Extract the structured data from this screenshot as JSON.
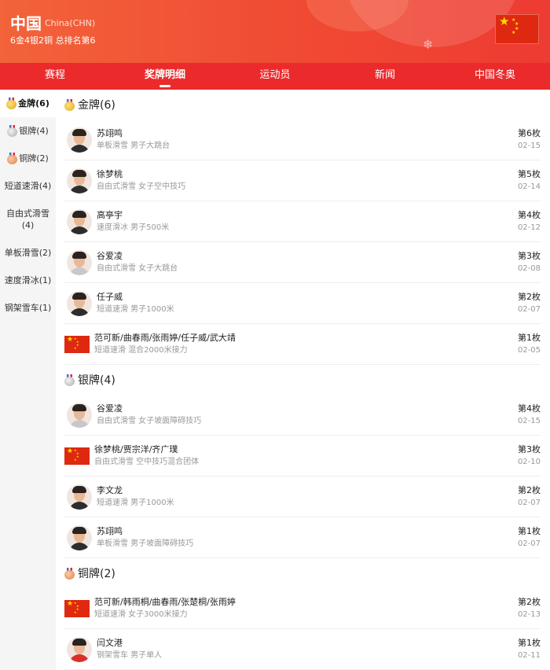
{
  "header": {
    "country_name": "中国",
    "country_code": "China(CHN)",
    "summary": "6金4银2铜 总排名第6"
  },
  "tabs": [
    {
      "label": "赛程",
      "active": false
    },
    {
      "label": "奖牌明细",
      "active": true
    },
    {
      "label": "运动员",
      "active": false
    },
    {
      "label": "新闻",
      "active": false
    },
    {
      "label": "中国冬奥",
      "active": false
    }
  ],
  "sidebar": {
    "items": [
      {
        "label": "金牌(6)",
        "medal": "gold",
        "active": true
      },
      {
        "label": "银牌(4)",
        "medal": "silver"
      },
      {
        "label": "铜牌(2)",
        "medal": "bronze"
      },
      {
        "label": "短道速滑(4)"
      },
      {
        "label": "自由式滑雪(4)"
      },
      {
        "label": "单板滑雪(2)"
      },
      {
        "label": "速度滑冰(1)"
      },
      {
        "label": "钢架雪车(1)"
      }
    ]
  },
  "sections": [
    {
      "title": "金牌(6)",
      "medal": "gold",
      "rows": [
        {
          "name": "苏翊鸣",
          "event": "单板滑雪 男子大跳台",
          "rank": "第6枚",
          "date": "02-15",
          "avatar": "athlete"
        },
        {
          "name": "徐梦桃",
          "event": "自由式滑雪 女子空中技巧",
          "rank": "第5枚",
          "date": "02-14",
          "avatar": "athlete"
        },
        {
          "name": "高亭宇",
          "event": "速度滑冰 男子500米",
          "rank": "第4枚",
          "date": "02-12",
          "avatar": "athlete"
        },
        {
          "name": "谷爱凌",
          "event": "自由式滑雪 女子大跳台",
          "rank": "第3枚",
          "date": "02-08",
          "avatar": "athlete-light"
        },
        {
          "name": "任子威",
          "event": "短道速滑 男子1000米",
          "rank": "第2枚",
          "date": "02-07",
          "avatar": "athlete"
        },
        {
          "name": "范可新/曲春雨/张雨婷/任子威/武大靖",
          "event": "短道速滑 混合2000米接力",
          "rank": "第1枚",
          "date": "02-05",
          "avatar": "flag"
        }
      ]
    },
    {
      "title": "银牌(4)",
      "medal": "silver",
      "rows": [
        {
          "name": "谷爱凌",
          "event": "自由式滑雪 女子坡面障碍技巧",
          "rank": "第4枚",
          "date": "02-15",
          "avatar": "athlete-light"
        },
        {
          "name": "徐梦桃/贾宗洋/齐广璞",
          "event": "自由式滑雪 空中技巧混合团体",
          "rank": "第3枚",
          "date": "02-10",
          "avatar": "flag"
        },
        {
          "name": "李文龙",
          "event": "短道速滑 男子1000米",
          "rank": "第2枚",
          "date": "02-07",
          "avatar": "athlete"
        },
        {
          "name": "苏翊鸣",
          "event": "单板滑雪 男子坡面障碍技巧",
          "rank": "第1枚",
          "date": "02-07",
          "avatar": "athlete"
        }
      ]
    },
    {
      "title": "铜牌(2)",
      "medal": "bronze",
      "rows": [
        {
          "name": "范可新/韩雨桐/曲春雨/张楚桐/张雨婷",
          "event": "短道速滑 女子3000米接力",
          "rank": "第2枚",
          "date": "02-13",
          "avatar": "flag"
        },
        {
          "name": "闫文港",
          "event": "钢架雪车 男子单人",
          "rank": "第1枚",
          "date": "02-11",
          "avatar": "athlete-red"
        }
      ]
    }
  ]
}
